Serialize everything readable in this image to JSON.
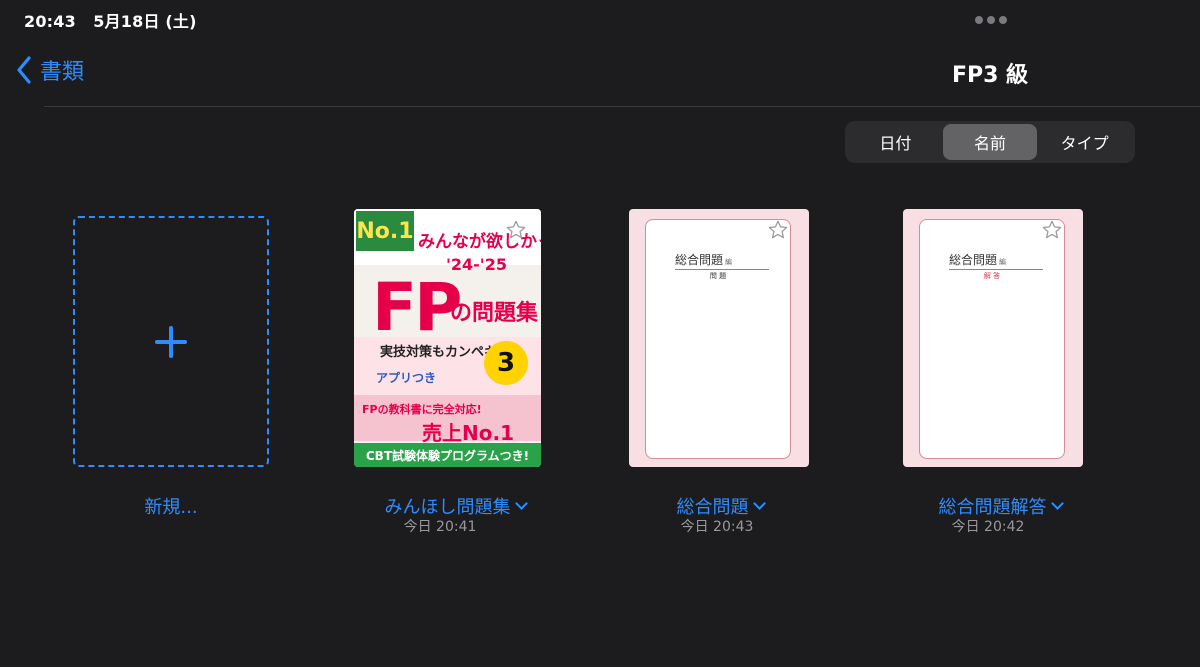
{
  "status_bar": {
    "time": "20:43",
    "date": "5月18日 (土)"
  },
  "nav": {
    "back_label": "書類",
    "title": "FP3 級"
  },
  "sort": {
    "options": [
      "日付",
      "名前",
      "タイプ"
    ],
    "selected": "名前"
  },
  "new_item": {
    "label": "新規..."
  },
  "documents": [
    {
      "title": "みんほし問題集",
      "date": "今日 20:41",
      "kind": "book-cover"
    },
    {
      "title": "総合問題",
      "date": "今日 20:43",
      "kind": "page",
      "page_heading": "総合問題",
      "page_heading_suffix": "編",
      "page_label": "問 題"
    },
    {
      "title": "総合問題解答",
      "date": "今日 20:42",
      "kind": "page",
      "page_heading": "総合問題",
      "page_heading_suffix": "編",
      "page_label": "解 答"
    }
  ],
  "cover": {
    "badge": "No.1",
    "headline": "みんなが欲しかった!",
    "year": "'24-'25",
    "main": "FP",
    "subtitle": "の問題集",
    "feature": "実技対策もカンペキ!",
    "grade": "3",
    "app": "アプリつき",
    "banner": "FPの教科書に完全対応!",
    "sales": "売上No.1",
    "cbt": "CBT試験体験プログラムつき!"
  },
  "colors": {
    "accent": "#2f8cff",
    "background": "#1c1c1e",
    "cover_red": "#e6004c"
  }
}
